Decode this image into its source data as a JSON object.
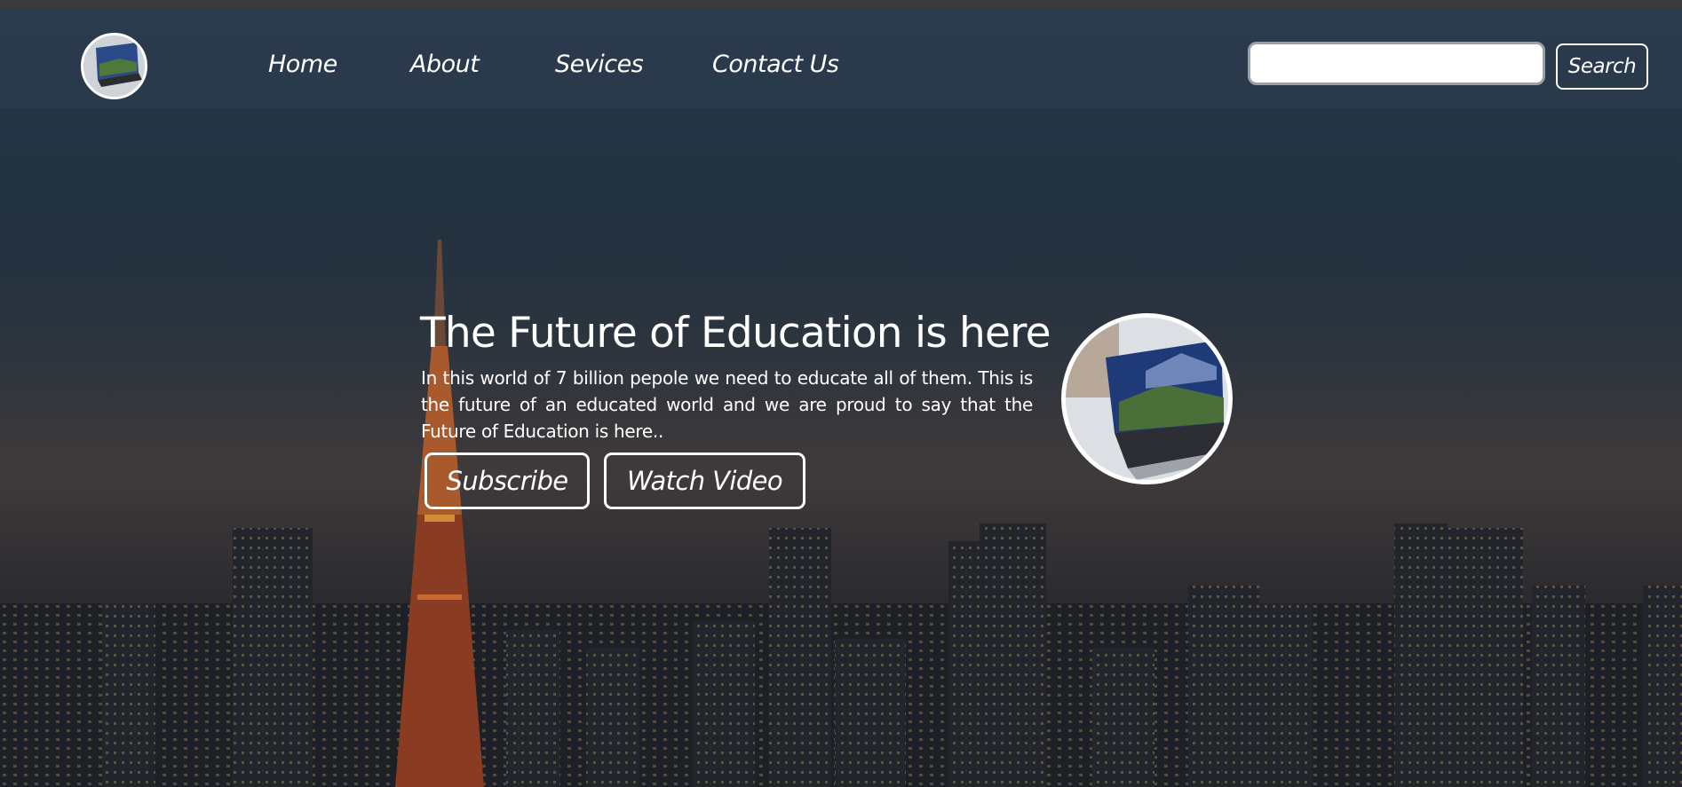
{
  "nav": {
    "logo_icon": "laptop-thumbnail-icon",
    "links": [
      {
        "label": "Home"
      },
      {
        "label": "About"
      },
      {
        "label": "Sevices"
      },
      {
        "label": "Contact Us"
      }
    ],
    "search": {
      "placeholder": "",
      "value": "",
      "button_label": "Search"
    }
  },
  "hero": {
    "title": "The Future of Education is here",
    "text": "In this world of 7 billion pepole we need to educate all of them. This is the future of an educated world and we are proud to say that the Future of Education is here..",
    "subscribe_label": "Subscribe",
    "watch_label": "Watch Video",
    "image_icon": "laptop-photo-icon"
  },
  "colors": {
    "overlay": "#2d3e50",
    "text": "#ffffff",
    "tower": "#c0552a"
  }
}
